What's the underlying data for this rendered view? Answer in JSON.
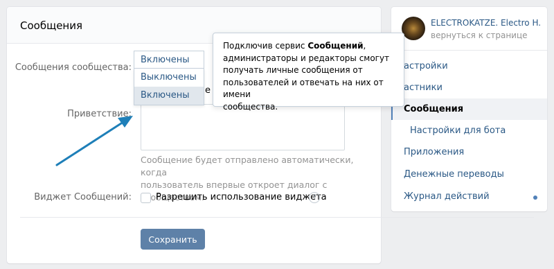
{
  "header": {
    "title": "Сообщения"
  },
  "form": {
    "community_messages_label": "Сообщения сообщества:",
    "select_value": "Включены",
    "options": [
      "Выключены",
      "Включены"
    ],
    "greeting_label": "Приветствие:",
    "obscured_text": "е",
    "hint_line1": "Сообщение будет отправлено автоматически, когда",
    "hint_line2": "пользователь впервые откроет диалог с сообществом.",
    "widget_label": "Виджет Сообщений:",
    "widget_checkbox_label": "Разрешить использование виджета",
    "help_glyph": "?",
    "save_label": "Сохранить"
  },
  "tooltip": {
    "line1_pre": "Подключив сервис ",
    "line1_bold": "Сообщений",
    "line1_post": ",",
    "line2": "администраторы и редакторы смогут",
    "line3": "получать личные сообщения от",
    "line4": "пользователей и отвечать на них от имени",
    "line5": "сообщества."
  },
  "sidebar": {
    "group_name": "ELECTROKATZE. Electro H...",
    "back_link": "вернуться к странице",
    "items": [
      {
        "label": "астройки"
      },
      {
        "label": "астники"
      },
      {
        "label": "Сообщения"
      },
      {
        "label": "Настройки для бота"
      },
      {
        "label": "Приложения"
      },
      {
        "label": "Денежные переводы"
      },
      {
        "label": "Журнал действий"
      }
    ]
  },
  "colors": {
    "accent": "#5181b8",
    "link": "#2a5885",
    "button": "#5e81a8",
    "arrow": "#1e7fb8"
  }
}
